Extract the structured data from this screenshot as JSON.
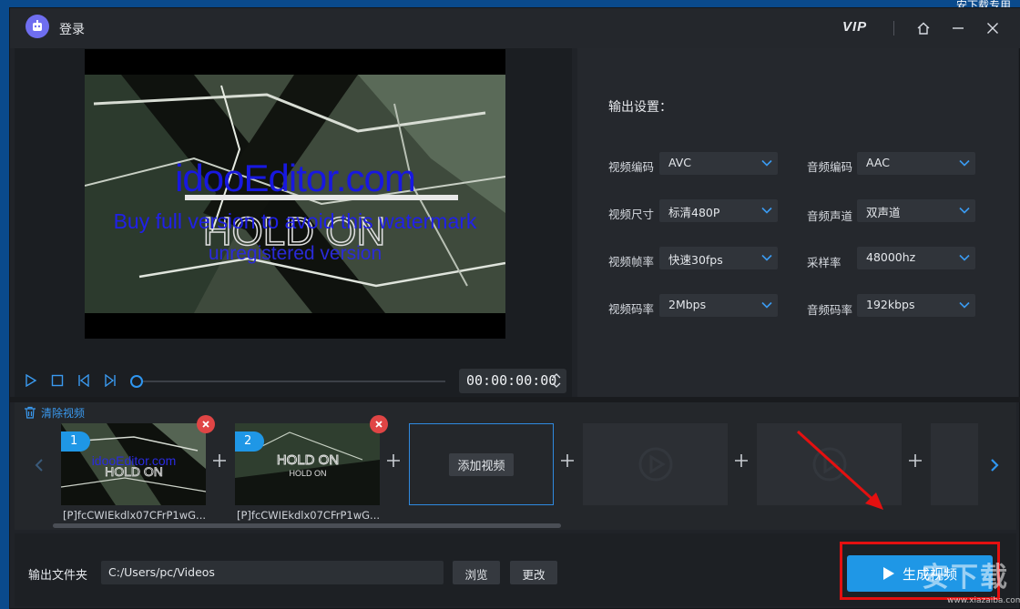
{
  "desktop": {
    "corner_text": "安下载专用"
  },
  "titlebar": {
    "title": "登录",
    "vip": "VIP"
  },
  "preview": {
    "watermark": {
      "line1": "idooEditor.com",
      "line2": "Buy full version to avoid this watermark",
      "line3": "unregistered version"
    },
    "time": "00:00:00:00"
  },
  "settings": {
    "title": "输出设置：",
    "video_codec": {
      "label": "视频编码",
      "value": "AVC"
    },
    "video_size": {
      "label": "视频尺寸",
      "value": "标清480P"
    },
    "video_fps": {
      "label": "视频帧率",
      "value": "快速30fps"
    },
    "video_bitrate": {
      "label": "视频码率",
      "value": "2Mbps"
    },
    "audio_codec": {
      "label": "音频编码",
      "value": "AAC"
    },
    "audio_channel": {
      "label": "音频声道",
      "value": "双声道"
    },
    "sample_rate": {
      "label": "采样率",
      "value": "48000hz"
    },
    "audio_bitrate": {
      "label": "音频码率",
      "value": "192kbps"
    }
  },
  "clips": {
    "clear_label": "清除视频",
    "items": [
      {
        "number": "1",
        "name": "[P]fcCWIEkdlx07CFrP1wG..."
      },
      {
        "number": "2",
        "name": "[P]fcCWIEkdlx07CFrP1wG..."
      }
    ],
    "add_label": "添加视频"
  },
  "footer": {
    "output_label": "输出文件夹",
    "output_path": "C:/Users/pc/Videos",
    "browse_label": "浏览",
    "change_label": "更改",
    "generate_label": "生成视频"
  },
  "overlay": {
    "site_mark": "安下载",
    "site_url": "www.xiazaiba.com"
  },
  "colors": {
    "accent": "#1f97e6",
    "annotation": "#e41010",
    "window_bg": "#202328"
  }
}
